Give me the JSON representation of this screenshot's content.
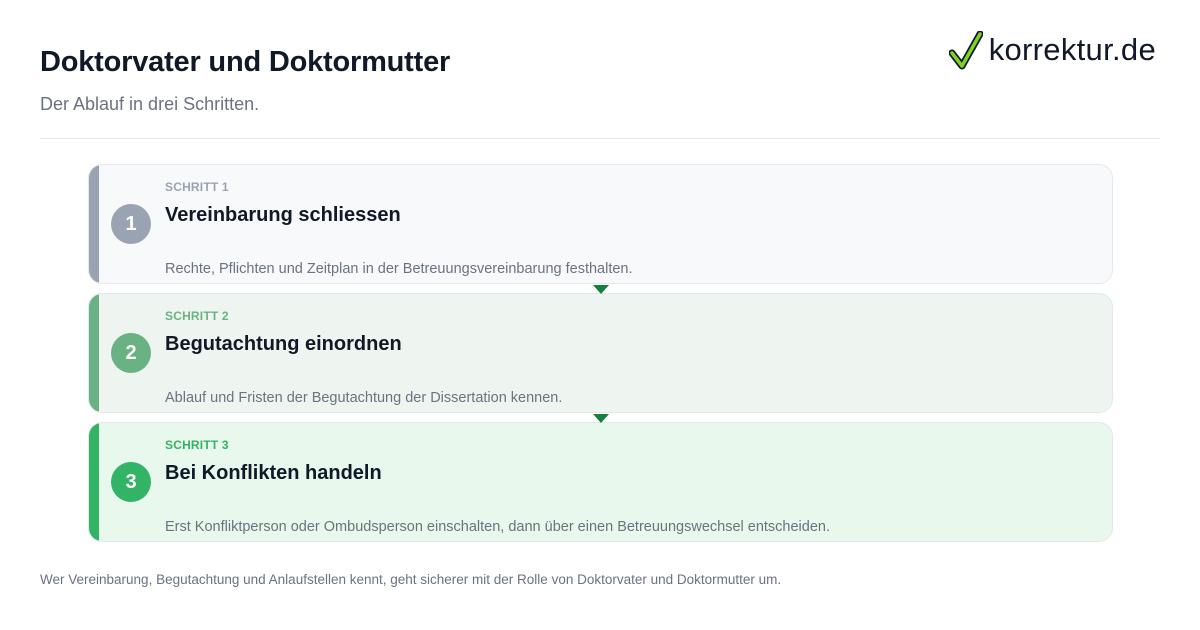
{
  "header": {
    "title": "Doktorvater und Doktormutter",
    "subtitle": "Der Ablauf in drei Schritten."
  },
  "logo": {
    "text": "korrektur.de",
    "icon": "checkmark-icon",
    "icon_color": "#22c55e"
  },
  "steps": [
    {
      "number": "1",
      "kicker": "SCHRITT 1",
      "heading": "Vereinbarung schliessen",
      "description": "Rechte, Pflichten und Zeitplan in der Betreuungsvereinbarung festhalten.",
      "accent": "#9aa3b2",
      "background": "#f8f9fb"
    },
    {
      "number": "2",
      "kicker": "SCHRITT 2",
      "heading": "Begutachtung einordnen",
      "description": "Ablauf und Fristen der Begutachtung der Dissertation kennen.",
      "accent": "#6ab283",
      "background": "#eef5f0"
    },
    {
      "number": "3",
      "kicker": "SCHRITT 3",
      "heading": "Bei Konflikten handeln",
      "description": "Erst Konfliktperson oder Ombudsperson einschalten, dann über einen Betreuungswechsel entscheiden.",
      "accent": "#33b366",
      "background": "#e8f8ec"
    }
  ],
  "connector_color": "#15803d",
  "footnote": "Wer Vereinbarung, Begutachtung und Anlaufstellen kennt, geht sicherer mit der Rolle von Doktorvater und Doktormutter um."
}
